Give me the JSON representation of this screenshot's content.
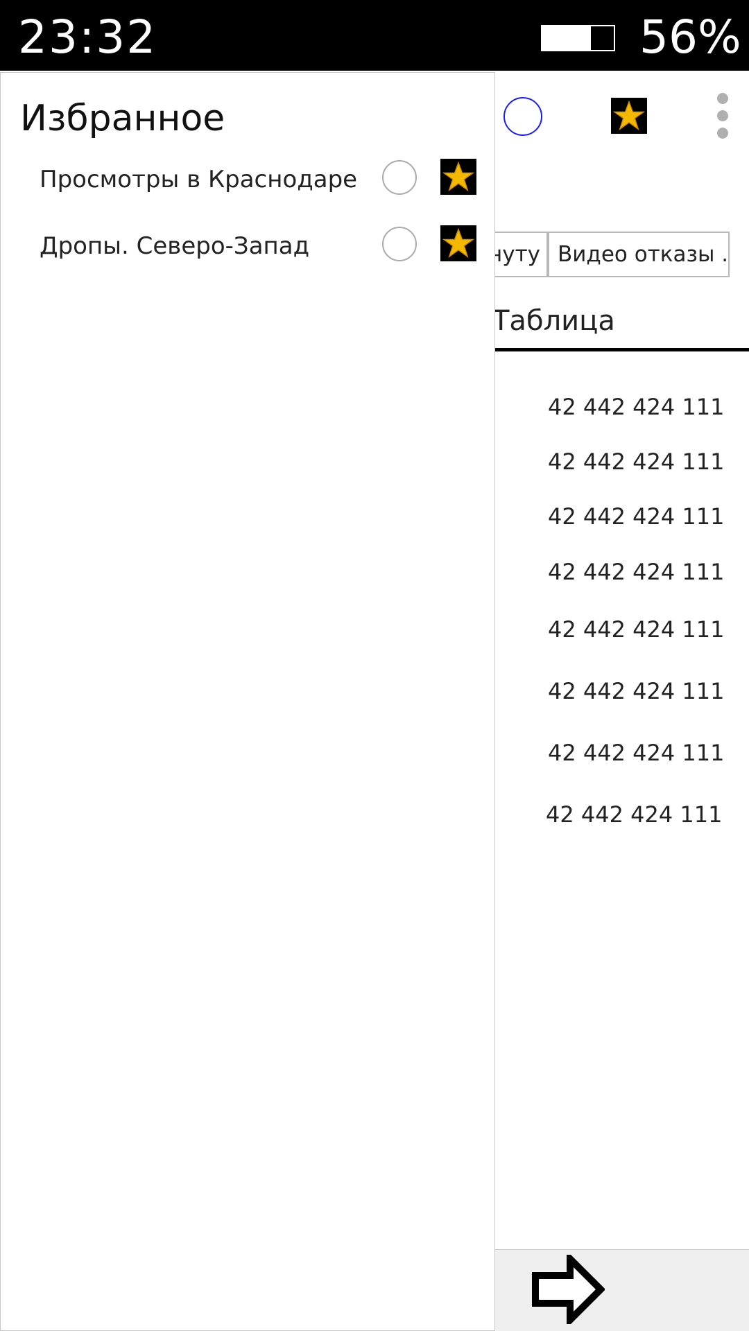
{
  "status_bar": {
    "time": "23:32",
    "battery_percent": "56%",
    "battery_level": 0.67
  },
  "background_screen": {
    "header_icons": [
      "circle-icon",
      "star-icon",
      "more-vert-icon"
    ],
    "filter_chips": [
      "нуту",
      "Видео отказы ..."
    ],
    "active_tab": "Таблица",
    "values": [
      "42 442 424 111",
      "42 442 424 111",
      "42 442 424 111",
      "42 442 424 111",
      "42 442 424 111",
      "42 442 424 111",
      "42 442 424 111",
      "42 442 424 111"
    ],
    "bottom_icon": "arrow-right-icon"
  },
  "drawer": {
    "title": "Избранное",
    "items": [
      {
        "label": "Просмотры в Краснодаре",
        "icons": [
          "circle-icon",
          "star-icon"
        ]
      },
      {
        "label": "Дропы. Северо-Запад",
        "icons": [
          "circle-icon",
          "star-icon"
        ]
      }
    ]
  },
  "colors": {
    "status_bar_bg": "#000000",
    "accent_circle": "#1a1aff",
    "star_fill": "#f5b800",
    "star_bg": "#000000",
    "bottom_bar_bg": "#efefef"
  }
}
